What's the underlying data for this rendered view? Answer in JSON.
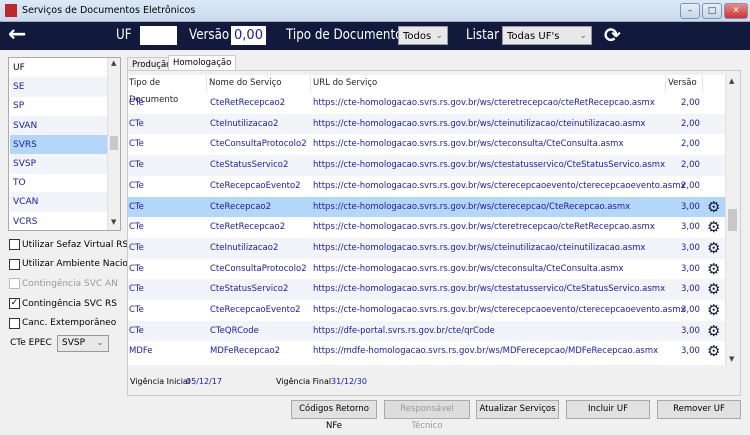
{
  "window": {
    "title": "Serviços de Documentos Eletrônicos",
    "app_icon_text": "NFe",
    "minimize": "–",
    "maximize": "□",
    "close": "✕"
  },
  "toolbar": {
    "back_icon": "←",
    "uf_label": "UF",
    "uf_value": "",
    "versao_label": "Versão",
    "versao_value": "0,00",
    "tipo_label": "Tipo de Documento",
    "tipo_value": "Todos",
    "listar_label": "Listar",
    "listar_value": "Todas UF's",
    "refresh_icon": "⟳"
  },
  "uf_list": [
    "UF",
    "SE",
    "SP",
    "SVAN",
    "SVRS",
    "SVSP",
    "TO",
    "VCAN",
    "VCRS"
  ],
  "uf_selected": "SVRS",
  "options": [
    {
      "label": "Utilizar Sefaz Virtual RS",
      "checked": false,
      "disabled": false
    },
    {
      "label": "Utilizar Ambiente Nacional",
      "checked": false,
      "disabled": false
    },
    {
      "label": "Contingência SVC AN",
      "checked": false,
      "disabled": true
    },
    {
      "label": "Contingência SVC RS",
      "checked": true,
      "disabled": false
    },
    {
      "label": "Canc. Extemporâneo",
      "checked": false,
      "disabled": false
    }
  ],
  "epec": {
    "label": "CTe EPEC",
    "value": "SVSP"
  },
  "tabs": [
    "Produção",
    "Homologação"
  ],
  "active_tab": "Homologação",
  "columns": [
    "Tipo de Documento",
    "Nome do Serviço",
    "URL do Serviço",
    "Versão"
  ],
  "rows": [
    {
      "tipo": "CTe",
      "nome": "CteRetRecepcao2",
      "url": "https://cte-homologacao.svrs.rs.gov.br/ws/cteretrecepcao/cteRetRecepcao.asmx",
      "versao": "2,00",
      "gear": false
    },
    {
      "tipo": "CTe",
      "nome": "CteInutilizacao2",
      "url": "https://cte-homologacao.svrs.rs.gov.br/ws/cteinutilizacao/cteinutilizacao.asmx",
      "versao": "2,00",
      "gear": false
    },
    {
      "tipo": "CTe",
      "nome": "CteConsultaProtocolo2",
      "url": "https://cte-homologacao.svrs.rs.gov.br/ws/cteconsulta/CteConsulta.asmx",
      "versao": "2,00",
      "gear": false
    },
    {
      "tipo": "CTe",
      "nome": "CteStatusServico2",
      "url": "https://cte-homologacao.svrs.rs.gov.br/ws/ctestatusservico/CteStatusServico.asmx",
      "versao": "2,00",
      "gear": false
    },
    {
      "tipo": "CTe",
      "nome": "CteRecepcaoEvento2",
      "url": "https://cte-homologacao.svrs.rs.gov.br/ws/cterecepcaoevento/cterecepcaoevento.asmx",
      "versao": "2,00",
      "gear": false
    },
    {
      "tipo": "CTe",
      "nome": "CteRecepcao2",
      "url": "https://cte-homologacao.svrs.rs.gov.br/ws/cterecepcao/CteRecepcao.asmx",
      "versao": "3,00",
      "gear": true,
      "selected": true
    },
    {
      "tipo": "CTe",
      "nome": "CteRetRecepcao2",
      "url": "https://cte-homologacao.svrs.rs.gov.br/ws/cteretrecepcao/cteRetRecepcao.asmx",
      "versao": "3,00",
      "gear": true
    },
    {
      "tipo": "CTe",
      "nome": "CteInutilizacao2",
      "url": "https://cte-homologacao.svrs.rs.gov.br/ws/cteinutilizacao/cteinutilizacao.asmx",
      "versao": "3,00",
      "gear": true
    },
    {
      "tipo": "CTe",
      "nome": "CteConsultaProtocolo2",
      "url": "https://cte-homologacao.svrs.rs.gov.br/ws/cteconsulta/CteConsulta.asmx",
      "versao": "3,00",
      "gear": true
    },
    {
      "tipo": "CTe",
      "nome": "CteStatusServico2",
      "url": "https://cte-homologacao.svrs.rs.gov.br/ws/ctestatusservico/CteStatusServico.asmx",
      "versao": "3,00",
      "gear": true
    },
    {
      "tipo": "CTe",
      "nome": "CteRecepcaoEvento2",
      "url": "https://cte-homologacao.svrs.rs.gov.br/ws/cterecepcaoevento/cterecepcaoevento.asmx",
      "versao": "3,00",
      "gear": true
    },
    {
      "tipo": "CTe",
      "nome": "CTeQRCode",
      "url": "https://dfe-portal.svrs.rs.gov.br/cte/qrCode",
      "versao": "3,00",
      "gear": true
    },
    {
      "tipo": "MDFe",
      "nome": "MDFeRecepcao2",
      "url": "https://mdfe-homologacao.svrs.rs.gov.br/ws/MDFerecepcao/MDFeRecepcao.asmx",
      "versao": "3,00",
      "gear": true
    }
  ],
  "vigencia": {
    "inicial_label": "Vigência Inicial",
    "inicial": "05/12/17",
    "final_label": "Vigência Final",
    "final": "31/12/30"
  },
  "buttons": {
    "codigos": "Códigos Retorno NFe",
    "responsavel": "Responsável Técnico",
    "atualizar": "Atualizar Serviços",
    "incluir": "Incluir UF",
    "remover": "Remover UF"
  }
}
